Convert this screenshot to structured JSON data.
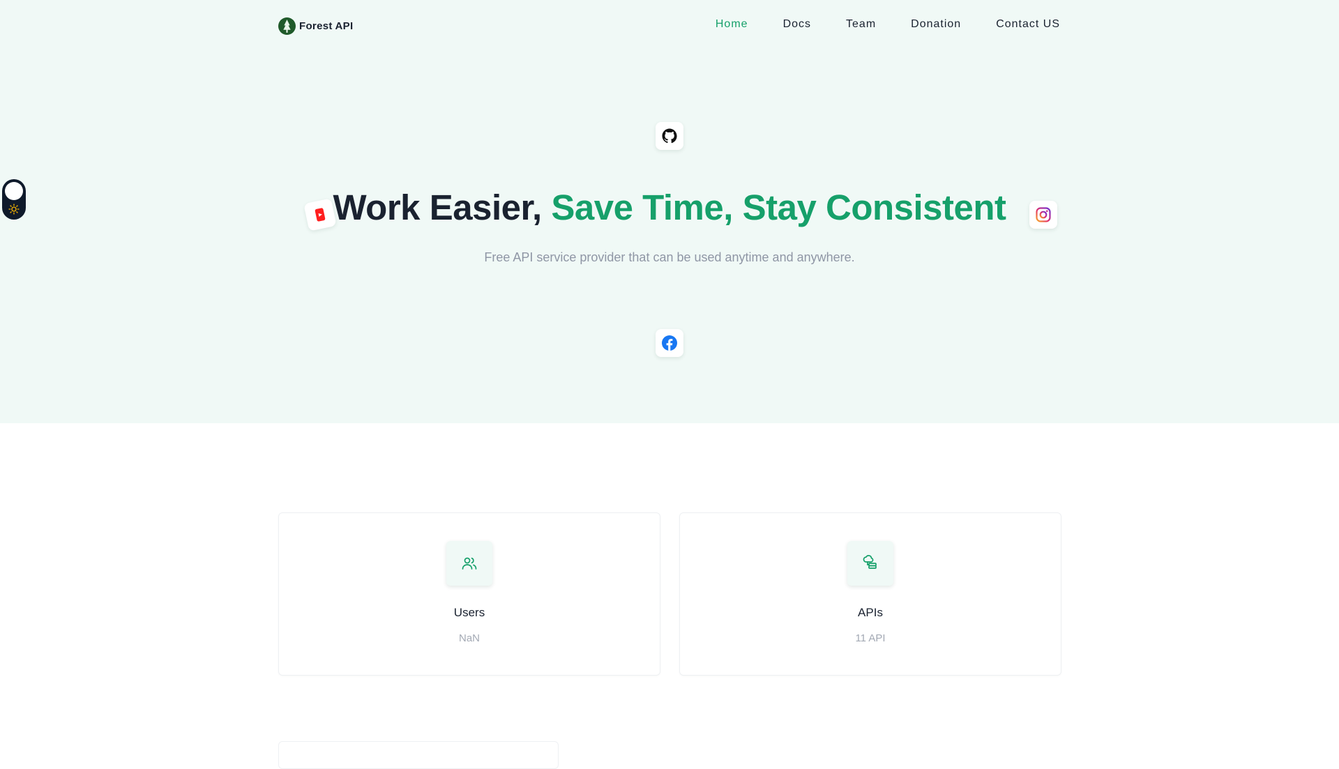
{
  "brand": {
    "name": "Forest API"
  },
  "nav": {
    "items": [
      {
        "label": "Home",
        "active": true
      },
      {
        "label": "Docs",
        "active": false
      },
      {
        "label": "Team",
        "active": false
      },
      {
        "label": "Donation",
        "active": false
      },
      {
        "label": "Contact US",
        "active": false
      }
    ]
  },
  "hero": {
    "headline_plain": "Work Easier, ",
    "headline_accent": "Save Time, Stay Consistent",
    "subtitle": "Free API service provider that can be used anytime and anywhere.",
    "social_icons": [
      "github-icon",
      "youtube-icon",
      "instagram-icon",
      "facebook-icon"
    ]
  },
  "stats": [
    {
      "title": "Users",
      "value": "NaN",
      "icon": "users-icon"
    },
    {
      "title": "APIs",
      "value": "11 API",
      "icon": "api-icon"
    }
  ],
  "theme_toggle": {
    "mode": "light",
    "icon": "sun-icon"
  },
  "colors": {
    "accent": "#16a06a",
    "hero_bg": "#f0f9f6",
    "text": "#1a2230",
    "muted": "#8f96a5",
    "toggle_bg": "#0f1a2b"
  }
}
